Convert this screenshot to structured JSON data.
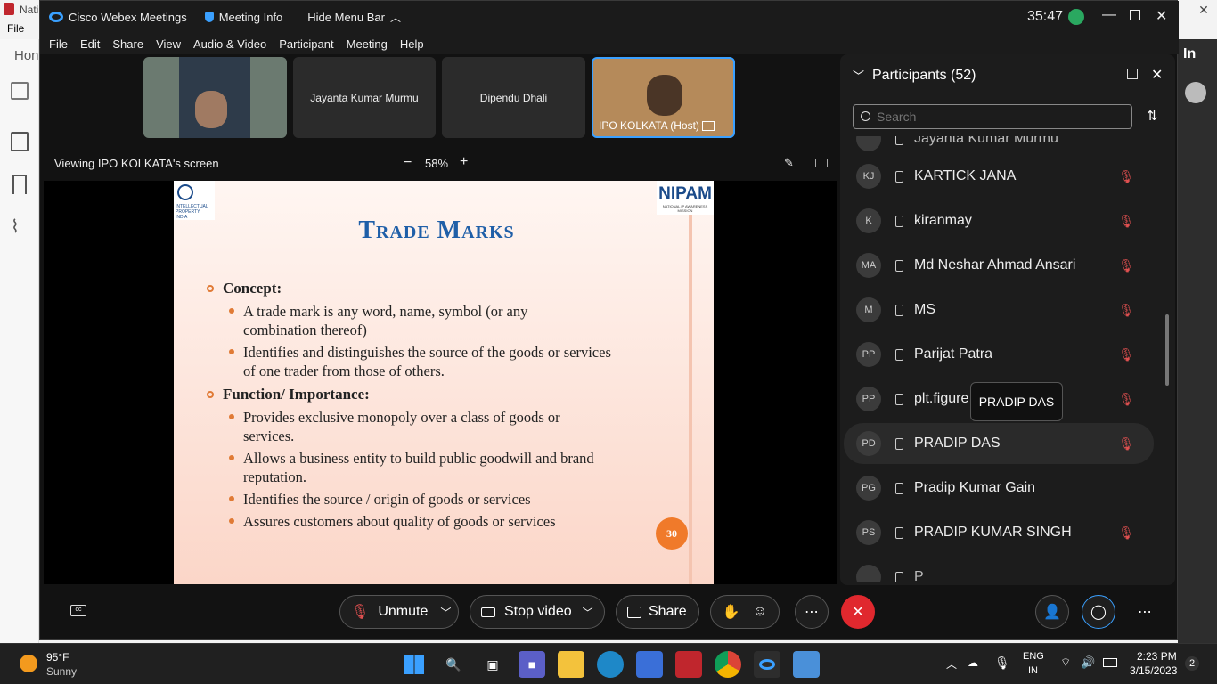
{
  "background_app": {
    "title_fragment": "Nati",
    "menu_file": "File",
    "home_fragment": "Hon",
    "right_fragment": "In"
  },
  "webex": {
    "app_name": "Cisco Webex Meetings",
    "meeting_info": "Meeting Info",
    "hide_menu_bar": "Hide Menu Bar",
    "timer": "35:47",
    "menu": [
      "File",
      "Edit",
      "Share",
      "View",
      "Audio & Video",
      "Participant",
      "Meeting",
      "Help"
    ],
    "tiles": [
      {
        "name": ""
      },
      {
        "name": "Jayanta Kumar Murmu"
      },
      {
        "name": "Dipendu Dhali"
      },
      {
        "name": "IPO KOLKATA (Host)"
      }
    ],
    "share_label": "Viewing IPO KOLKATA's screen",
    "zoom": "58%",
    "slide": {
      "logo_left": "INTELLECTUAL PROPERTY INDIA",
      "logo_right": "NIPAM",
      "logo_right_sub": "NATIONAL IP AWARENESS MISSION",
      "title": "Trade Marks",
      "concept_heading": "Concept:",
      "concept_items": [
        "A trade mark is any word, name, symbol (or any combination thereof)",
        "Identifies and distinguishes the source of the goods or services of one trader from those of others."
      ],
      "function_heading": "Function/ Importance:",
      "function_items": [
        "Provides exclusive monopoly over a class of goods or services.",
        "Allows a business entity to build public goodwill and brand reputation.",
        "Identifies the source / origin of goods or services",
        "Assures customers about quality of goods or services"
      ],
      "page_number": "30"
    },
    "controls": {
      "unmute": "Unmute",
      "stop_video": "Stop video",
      "share": "Share"
    },
    "participants": {
      "header": "Participants (52)",
      "search_placeholder": "Search",
      "partial_top": "Jayanta Kumar Murmu",
      "rows": [
        {
          "initials": "KJ",
          "name": "KARTICK JANA"
        },
        {
          "initials": "K",
          "name": "kiranmay"
        },
        {
          "initials": "MA",
          "name": "Md Neshar Ahmad Ansari"
        },
        {
          "initials": "M",
          "name": "MS"
        },
        {
          "initials": "PP",
          "name": "Parijat Patra"
        },
        {
          "initials": "PP",
          "name": "plt.figure rX,Y..."
        },
        {
          "initials": "PD",
          "name": "PRADIP DAS"
        },
        {
          "initials": "PG",
          "name": "Pradip Kumar Gain"
        },
        {
          "initials": "PS",
          "name": "PRADIP KUMAR SINGH"
        }
      ],
      "partial_bottom": "P",
      "tooltip": "PRADIP DAS"
    }
  },
  "taskbar": {
    "weather_temp": "95°F",
    "weather_desc": "Sunny",
    "lang": "ENG",
    "region": "IN",
    "time": "2:23 PM",
    "date": "3/15/2023",
    "notifications": "2"
  }
}
